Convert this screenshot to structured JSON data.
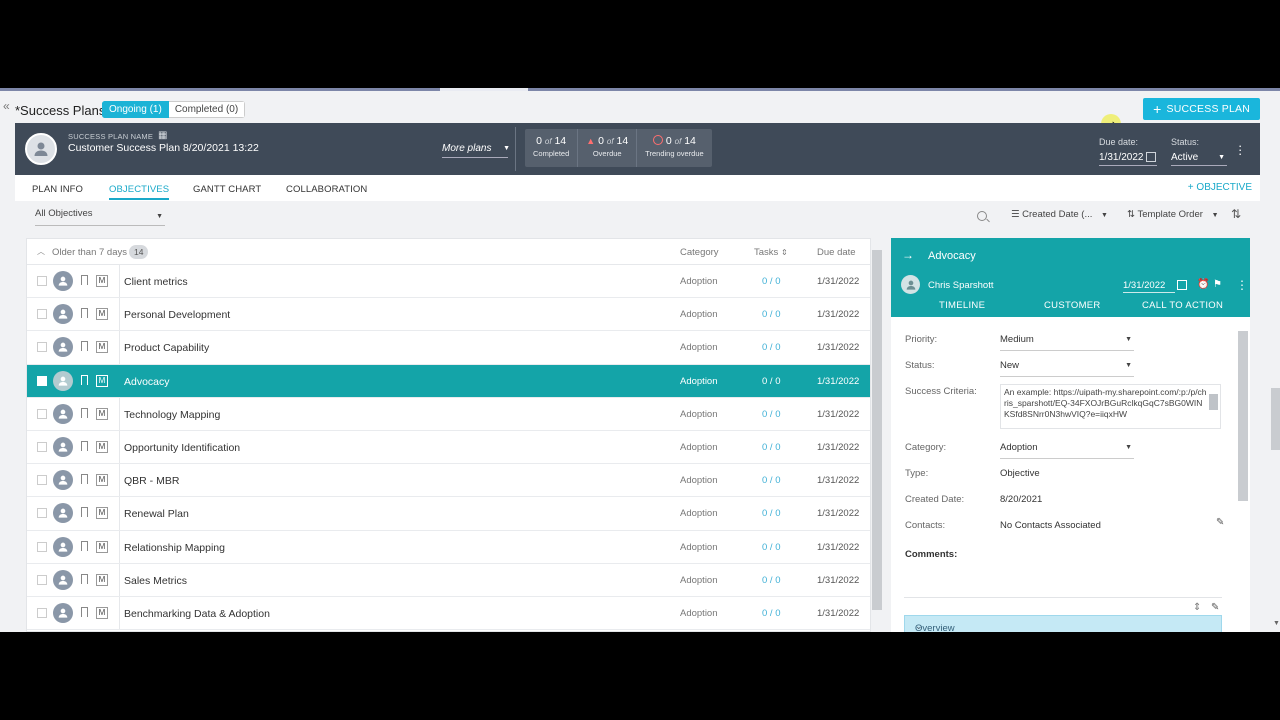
{
  "page": {
    "title": "*Success Plans",
    "segments": {
      "ongoing": "Ongoing (1)",
      "completed": "Completed (0)"
    },
    "add_success_plan": "SUCCESS PLAN"
  },
  "header": {
    "plan_name_label": "SUCCESS PLAN NAME",
    "plan_name": "Customer Success Plan 8/20/2021 13:22",
    "more_plans": "More plans",
    "stats": {
      "completed": {
        "count": "0",
        "of": "of",
        "total": "14",
        "label": "Completed"
      },
      "overdue": {
        "count": "0",
        "of": "of",
        "total": "14",
        "label": "Overdue"
      },
      "trending": {
        "count": "0",
        "of": "of",
        "total": "14",
        "label": "Trending overdue"
      }
    },
    "due_date_label": "Due date:",
    "due_date": "1/31/2022",
    "status_label": "Status:",
    "status": "Active"
  },
  "tabs": [
    {
      "label": "PLAN INFO"
    },
    {
      "label": "OBJECTIVES"
    },
    {
      "label": "GANTT CHART"
    },
    {
      "label": "COLLABORATION"
    }
  ],
  "add_objective": "OBJECTIVE",
  "filters": {
    "objectives_filter": "All Objectives",
    "sort_by": "Created Date (...",
    "order_by": "Template Order"
  },
  "list": {
    "group_label": "Older than 7 days",
    "group_count": "14",
    "columns": {
      "category": "Category",
      "tasks": "Tasks",
      "due": "Due date"
    },
    "rows": [
      {
        "name": "Client metrics",
        "category": "Adoption",
        "tasks": "0 / 0",
        "due": "1/31/2022"
      },
      {
        "name": "Personal Development",
        "category": "Adoption",
        "tasks": "0 / 0",
        "due": "1/31/2022"
      },
      {
        "name": "Product Capability",
        "category": "Adoption",
        "tasks": "0 / 0",
        "due": "1/31/2022"
      },
      {
        "name": "Advocacy",
        "category": "Adoption",
        "tasks": "0 / 0",
        "due": "1/31/2022"
      },
      {
        "name": "Technology Mapping",
        "category": "Adoption",
        "tasks": "0 / 0",
        "due": "1/31/2022"
      },
      {
        "name": "Opportunity Identification",
        "category": "Adoption",
        "tasks": "0 / 0",
        "due": "1/31/2022"
      },
      {
        "name": "QBR - MBR",
        "category": "Adoption",
        "tasks": "0 / 0",
        "due": "1/31/2022"
      },
      {
        "name": "Renewal Plan",
        "category": "Adoption",
        "tasks": "0 / 0",
        "due": "1/31/2022"
      },
      {
        "name": "Relationship Mapping",
        "category": "Adoption",
        "tasks": "0 / 0",
        "due": "1/31/2022"
      },
      {
        "name": "Sales Metrics",
        "category": "Adoption",
        "tasks": "0 / 0",
        "due": "1/31/2022"
      },
      {
        "name": "Benchmarking Data & Adoption",
        "category": "Adoption",
        "tasks": "0 / 0",
        "due": "1/31/2022"
      }
    ],
    "row_marker": "M",
    "selected_index": 3
  },
  "detail": {
    "title": "Advocacy",
    "owner": "Chris Sparshott",
    "due_date": "1/31/2022",
    "tabs": [
      "TIMELINE",
      "CUSTOMER",
      "CALL TO ACTION"
    ],
    "fields": {
      "priority_label": "Priority:",
      "priority": "Medium",
      "status_label": "Status:",
      "status": "New",
      "criteria_label": "Success Criteria:",
      "criteria": "An example: https://uipath-my.sharepoint.com/:p:/p/chris_sparshott/EQ-34FXOJrBGuRclkqGqC7sBG0WINKSfd8SNrr0N3hwVIQ?e=iiqxHW",
      "category_label": "Category:",
      "category": "Adoption",
      "type_label": "Type:",
      "type": "Objective",
      "created_label": "Created Date:",
      "created": "8/20/2021",
      "contacts_label": "Contacts:",
      "contacts": "No Contacts Associated",
      "comments_label": "Comments:"
    },
    "overview": "Overview"
  },
  "colors": {
    "accent": "#1ab6dc",
    "teal": "#14a4a8",
    "header": "#3f4a58"
  }
}
